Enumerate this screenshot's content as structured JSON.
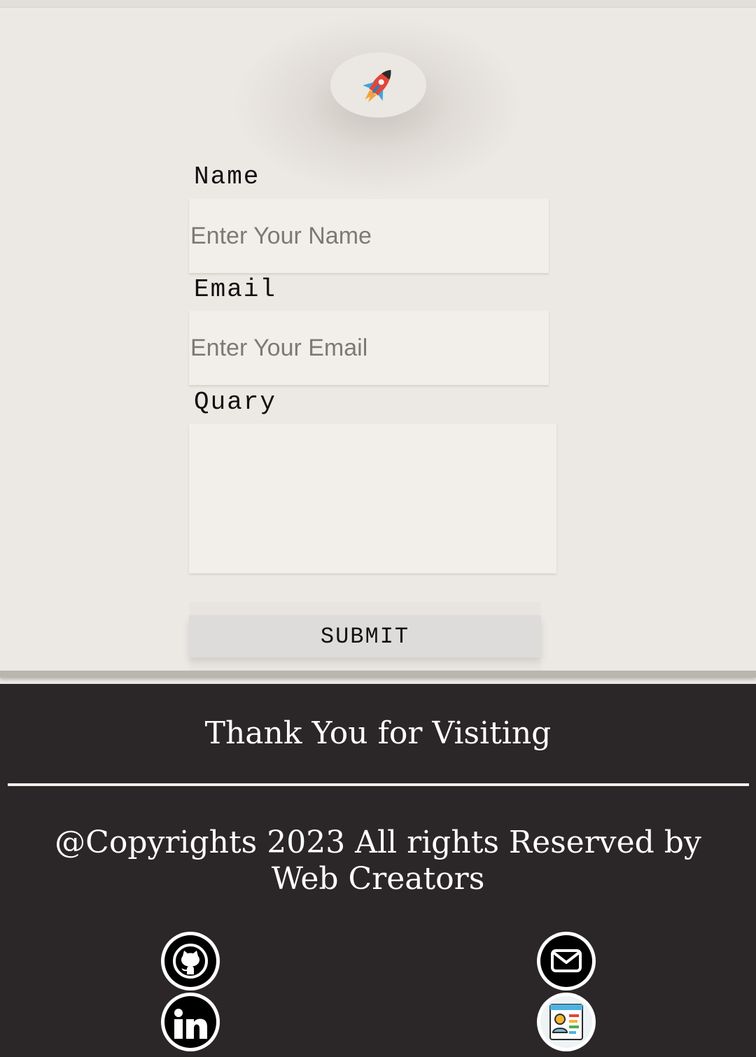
{
  "form": {
    "name_label": "Name",
    "name_placeholder": "Enter Your Name",
    "email_label": "Email",
    "email_placeholder": "Enter Your Email",
    "query_label": "Quary",
    "submit_label": "SUBMIT"
  },
  "footer": {
    "thanks": "Thank You for Visiting",
    "copyright": "@Copyrights 2023 All rights Reserved by Web Creators",
    "social_icons": [
      "github-icon",
      "mail-icon",
      "linkedin-icon",
      "resume-icon"
    ]
  },
  "logo": {
    "icon": "rocket-icon"
  },
  "colors": {
    "page_bg": "#ece8e3",
    "input_bg": "#f2efeb",
    "button_bg": "#dddcdb",
    "footer_bg": "#2b2627",
    "rocket_red": "#e4453a",
    "rocket_blue": "#3da5dc"
  }
}
